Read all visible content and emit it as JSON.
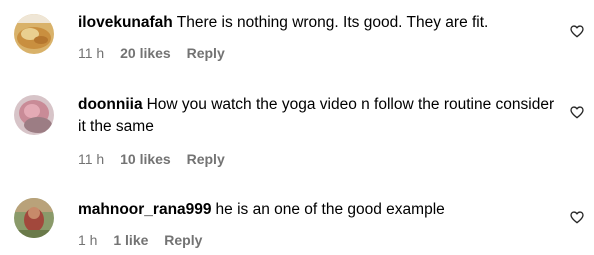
{
  "comments": [
    {
      "username": "ilovekunafah",
      "text": "There is nothing wrong. Its good. They are fit.",
      "time": "11 h",
      "likes": "20 likes",
      "reply": "Reply",
      "avatar_icon": "food-photo-avatar",
      "like_icon": "heart-outline-icon"
    },
    {
      "username": "doonniia",
      "text": "How you watch the yoga video n follow the routine consider it the same",
      "time": "11 h",
      "likes": "10 likes",
      "reply": "Reply",
      "avatar_icon": "photo-avatar",
      "like_icon": "heart-outline-icon"
    },
    {
      "username": "mahnoor_rana999",
      "text": "he is an one of the good example",
      "time": "1 h",
      "likes": "1 like",
      "reply": "Reply",
      "avatar_icon": "photo-avatar",
      "like_icon": "heart-outline-icon"
    }
  ],
  "colors": {
    "meta_text": "#737373",
    "primary_text": "#000000",
    "background": "#ffffff"
  }
}
